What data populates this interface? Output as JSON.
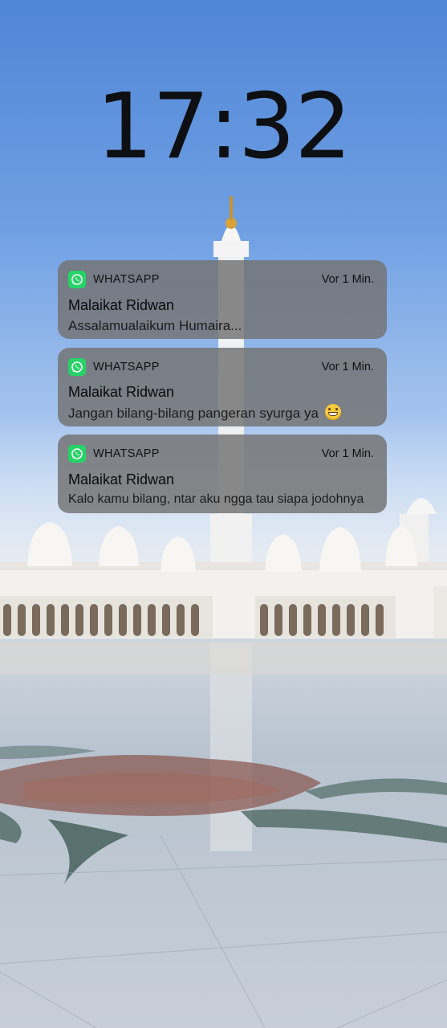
{
  "lockscreen": {
    "time": "17:32"
  },
  "notifications": [
    {
      "app": "WHATSAPP",
      "app_icon": "whatsapp-icon",
      "time": "Vor 1 Min.",
      "sender": "Malaikat Ridwan",
      "message": "Assalamualaikum Humaira..."
    },
    {
      "app": "WHATSAPP",
      "app_icon": "whatsapp-icon",
      "time": "Vor 1 Min.",
      "sender": "Malaikat Ridwan",
      "message": "Jangan bilang-bilang pangeran syurga ya",
      "emoji": "grinning-face-emoji"
    },
    {
      "app": "WHATSAPP",
      "app_icon": "whatsapp-icon",
      "time": "Vor 1 Min.",
      "sender": "Malaikat Ridwan",
      "message": "Kalo kamu bilang, ntar aku ngga tau siapa jodohnya"
    }
  ],
  "colors": {
    "whatsapp_green": "#25d366",
    "notification_bg": "#737373",
    "sky": "#6f9fe3"
  }
}
